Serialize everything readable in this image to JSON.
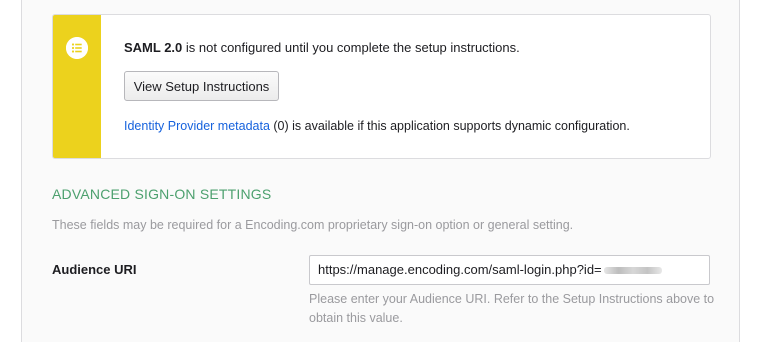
{
  "saml_notice": {
    "protocol": "SAML 2.0",
    "message": " is not configured until you complete the setup instructions.",
    "button_label": "View Setup Instructions",
    "metadata_link": "Identity Provider metadata",
    "metadata_suffix": " (0) is available if this application supports dynamic configuration."
  },
  "advanced": {
    "title": "ADVANCED SIGN-ON SETTINGS",
    "description": "These fields may be required for a Encoding.com proprietary sign-on option or general setting."
  },
  "audience_uri": {
    "label": "Audience URI",
    "value": "https://manage.encoding.com/saml-login.php?id=",
    "help": "Please enter your Audience URI. Refer to the Setup Instructions above to obtain this value."
  },
  "colors": {
    "notice_bar": "#ecd21d",
    "section_title": "#4ca06e",
    "link": "#1662dd"
  },
  "icons": {
    "notice": "list-icon"
  }
}
